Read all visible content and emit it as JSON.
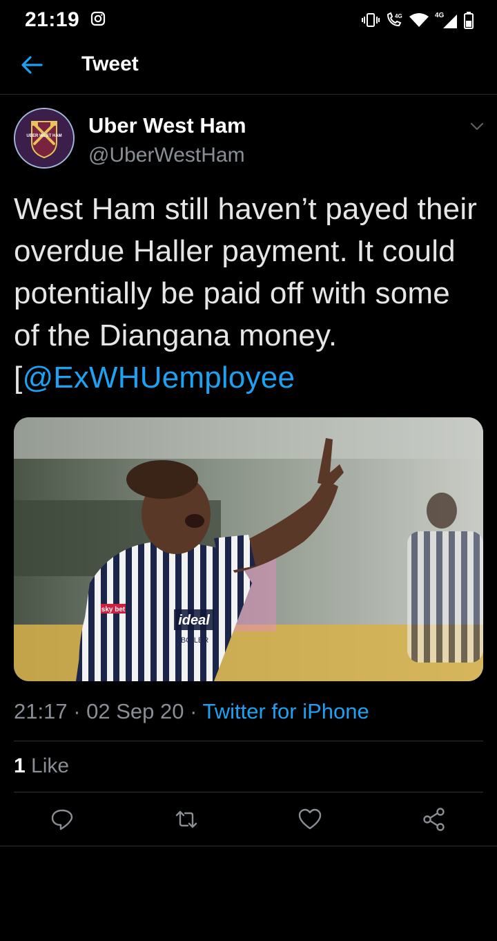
{
  "status_bar": {
    "time": "21:19",
    "icons": [
      "instagram-icon",
      "vibrate-icon",
      "volte-call-icon",
      "wifi-icon",
      "4g-signal-icon",
      "battery-icon"
    ],
    "network_label": "4G"
  },
  "header": {
    "back_icon": "arrow-left-icon",
    "title": "Tweet"
  },
  "tweet": {
    "author_name": "Uber West Ham",
    "author_handle": "@UberWestHam",
    "avatar_text": "UBER WEST HAM",
    "text_before": "West Ham still haven’t payed their overdue Haller payment. It could potentially be paid off with some of the Diangana money. [",
    "mention": "@ExWHUemployee",
    "time": "21:17",
    "date": "02 Sep 20",
    "separator": " · ",
    "source": "Twitter for iPhone",
    "likes_count": "1",
    "likes_label": " Like"
  },
  "media": {
    "shirt_texts": [
      "ideal",
      "BOILER"
    ],
    "sponsor_badge": "sky bet"
  },
  "actions": [
    "reply-icon",
    "retweet-icon",
    "like-icon",
    "share-icon"
  ],
  "colors": {
    "accent": "#1da1f2",
    "muted": "#8a8f95",
    "background": "#000000"
  }
}
